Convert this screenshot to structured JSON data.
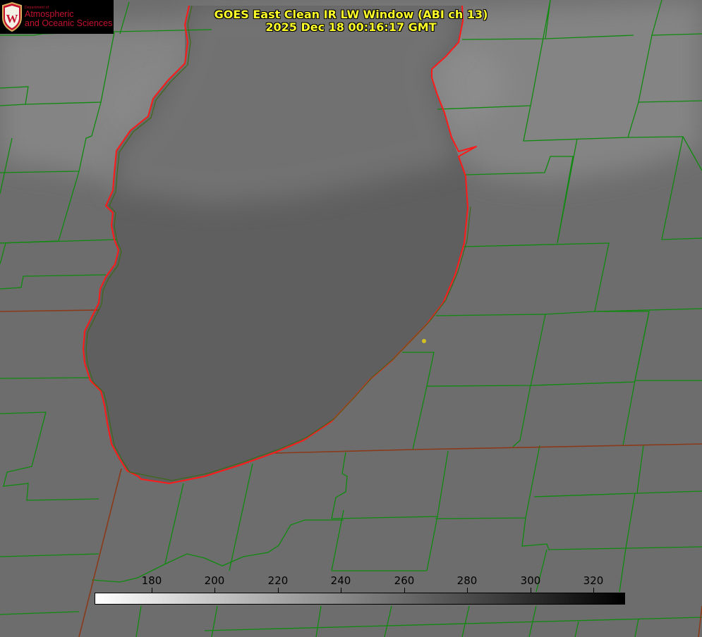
{
  "header": {
    "title_line1": "GOES East Clean IR LW Window (ABI ch 13)",
    "title_line2": "2025 Dec 18 00:16:17 GMT"
  },
  "logo": {
    "department": "Department of",
    "line1": "Atmospheric",
    "line2": "and Oceanic Sciences",
    "crest_letter": "W"
  },
  "colorbar": {
    "ticks": [
      "180",
      "200",
      "220",
      "240",
      "260",
      "280",
      "300",
      "320"
    ],
    "gradient_start": "#ffffff",
    "gradient_end": "#000000"
  },
  "map": {
    "land_color": "#6e6e6e",
    "cloud_color": "#8a8a8a",
    "lake_color": "#5e5e5e",
    "county_line_color": "#0f8a0f",
    "state_line_color": "#8a3a1a",
    "coastline_color": "#ff1a1a",
    "marker_color": "#d4c020"
  }
}
